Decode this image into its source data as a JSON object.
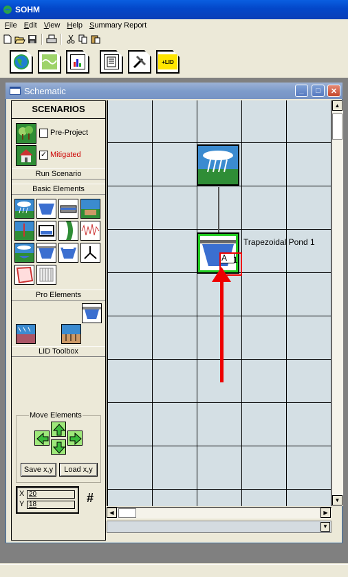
{
  "app": {
    "title": "SOHM"
  },
  "menu": [
    {
      "label": "File",
      "key": "F"
    },
    {
      "label": "Edit",
      "key": "E"
    },
    {
      "label": "View",
      "key": "V"
    },
    {
      "label": "Help",
      "key": "H"
    },
    {
      "label": "Summary Report",
      "key": "S"
    }
  ],
  "toolbar_icons": [
    "new-file-icon",
    "open-folder-icon",
    "save-icon",
    "print-icon",
    "cut-icon",
    "copy-icon",
    "paste-icon"
  ],
  "big_toolbar_icons": [
    "globe-icon",
    "map-icon",
    "chart-icon",
    "report-icon",
    "tools-icon",
    "lid-icon"
  ],
  "big_toolbar_lid_text": "+LID",
  "schematic": {
    "title": "Schematic",
    "window_buttons": [
      "minimize",
      "maximize",
      "close"
    ]
  },
  "panel": {
    "scenarios_title": "SCENARIOS",
    "pre_project_label": "Pre-Project",
    "pre_project_checked": false,
    "mitigated_label": "Mitigated",
    "mitigated_checked": true,
    "mitigated_check_mark": "✓",
    "run_scenario": "Run Scenario",
    "basic_elements": "Basic Elements",
    "pro_elements": "Pro Elements",
    "lid_toolbox": "LID Toolbox",
    "move_elements": "Move Elements",
    "save_xy": "Save x,y",
    "load_xy": "Load x,y",
    "x_label": "X",
    "x_value": "20",
    "y_label": "Y",
    "y_value": "18",
    "grid_symbol": "#"
  },
  "canvas": {
    "node_label": "Trapezoidal Pond  1",
    "pond_badge": "A",
    "pond_badge_number": "1"
  },
  "colors": {
    "grid_bg": "#d4dfe4",
    "highlight_red": "#ee0000",
    "selected_green": "#22cc22",
    "mitigated_text": "#cc0000"
  }
}
